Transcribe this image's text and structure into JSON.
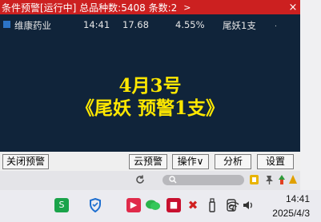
{
  "window": {
    "title": "条件预警[运行中] 总品种数:5408 条数:2",
    "menu_arrow": ">",
    "close": "×"
  },
  "alert_row": {
    "name": "维康药业",
    "time": "14:41",
    "price": "17.68",
    "change_pct": "4.55%",
    "reason": "尾妖1支",
    "marker": "."
  },
  "banner": {
    "line1": "4月3号",
    "line2": "《尾妖  预警1支》"
  },
  "buttons": {
    "close_alert": "关闭预警",
    "cloud_alert": "云预警",
    "operation": "操作∨",
    "analysis": "分析",
    "settings": "设置"
  },
  "tray_icons": [
    "refresh-icon",
    "search-pill",
    "notification-icon",
    "pin-icon",
    "up-arrow-icon",
    "warning-icon"
  ],
  "taskbar_icons": [
    "app-green-icon",
    "shield-icon",
    "app-red-icon",
    "wechat-icon",
    "app-square-icon",
    "app-cross-icon",
    "usb-icon",
    "speaker-icon",
    "wifi-icon",
    "volume-icon"
  ],
  "clock": {
    "time": "14:41",
    "date": "2025/4/3"
  },
  "colors": {
    "titlebar": "#cc2020",
    "panel": "#10243a",
    "banner_text": "#ffe800"
  }
}
